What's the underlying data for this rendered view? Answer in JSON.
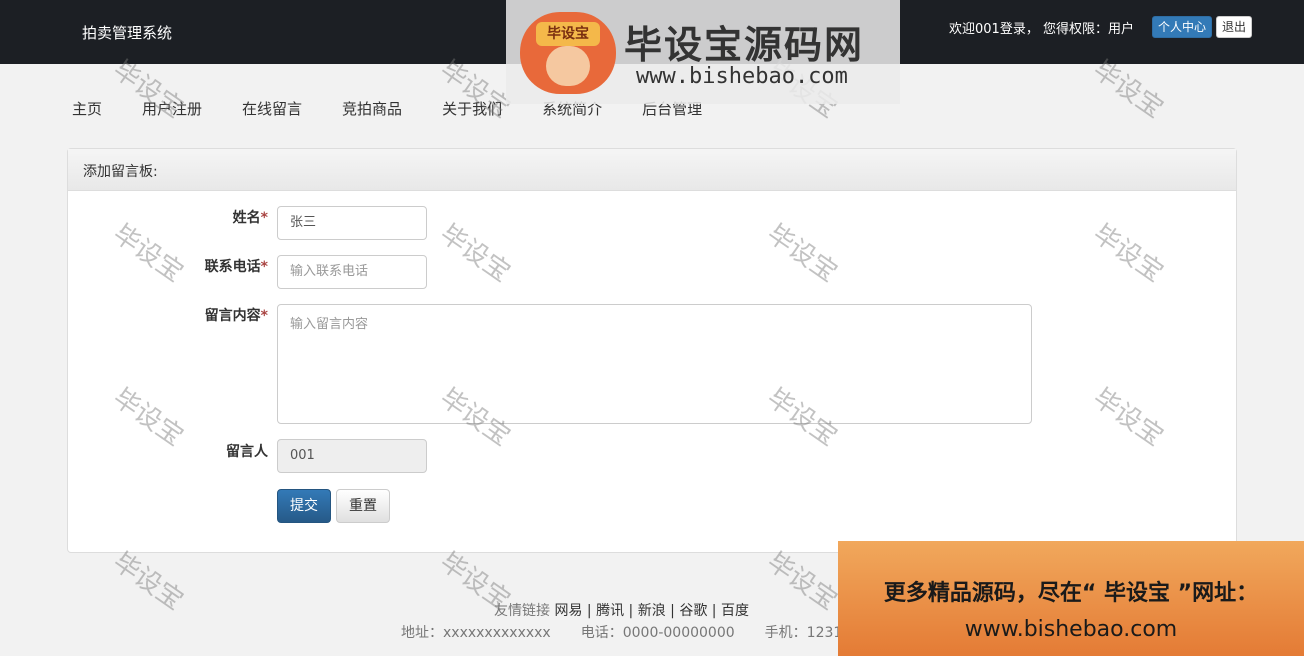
{
  "header": {
    "brand": "拍卖管理系统",
    "welcome": "欢迎001登录，  您得权限：用户",
    "center_btn": "个人中心",
    "logout_btn": "退出"
  },
  "nav": [
    "主页",
    "用户注册",
    "在线留言",
    "竞拍商品",
    "关于我们",
    "系统简介",
    "后台管理"
  ],
  "panel": {
    "title": "添加留言板:",
    "form": {
      "name_label": "姓名",
      "name_value": "张三",
      "phone_label": "联系电话",
      "phone_placeholder": "输入联系电话",
      "content_label": "留言内容",
      "content_placeholder": "输入留言内容",
      "author_label": "留言人",
      "author_value": "001",
      "required_mark": "*"
    },
    "submit_btn": "提交",
    "reset_btn": "重置"
  },
  "footer": {
    "links_label": "友情链接",
    "links": [
      "网易 |",
      "腾讯 |",
      "新浪 |",
      "谷歌 |",
      "百度"
    ],
    "address": "地址：xxxxxxxxxxxxx",
    "phone": "电话：0000-00000000",
    "mobile": "手机：1231"
  },
  "watermark": {
    "text": "毕设宝",
    "logo_tag": "毕设宝",
    "logo_title": "毕设宝源码网",
    "logo_url": "www.bishebao.com"
  },
  "promo": {
    "line1": "更多精品源码，尽在“ 毕设宝 ”网址：",
    "line2": "www.bishebao.com"
  }
}
